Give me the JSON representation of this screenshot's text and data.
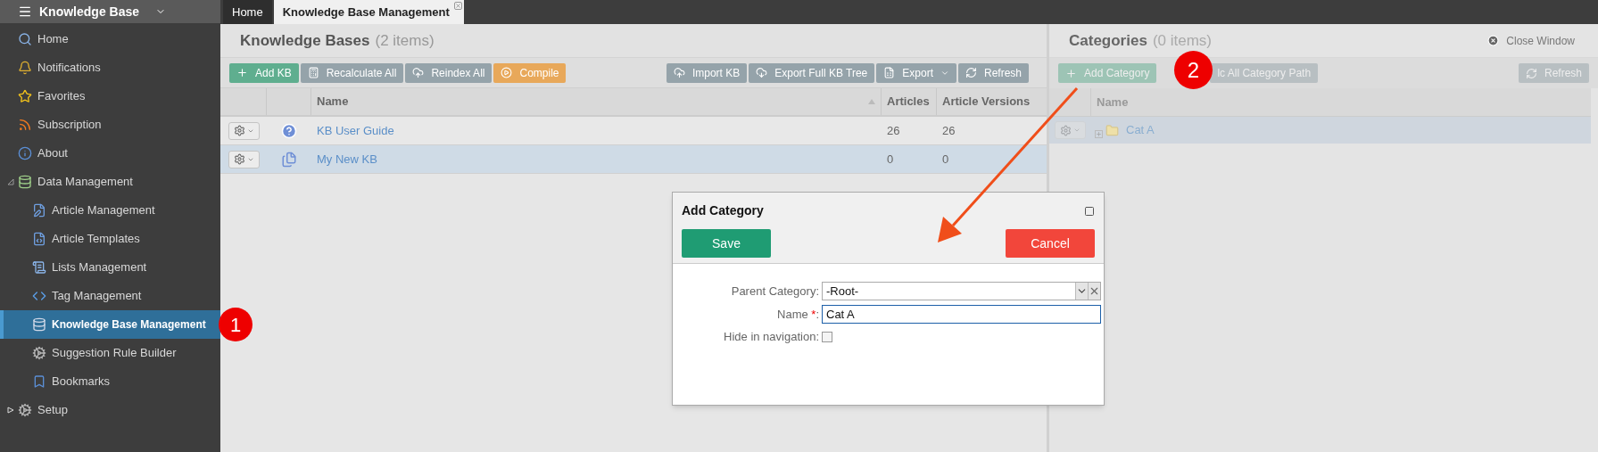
{
  "sidebar": {
    "title": "Knowledge Base",
    "items": [
      {
        "label": "Home",
        "selected": false
      },
      {
        "label": "Notifications",
        "selected": false
      },
      {
        "label": "Favorites",
        "selected": false
      },
      {
        "label": "Subscription",
        "selected": false
      },
      {
        "label": "About",
        "selected": false
      },
      {
        "label": "Data Management",
        "selected": false,
        "expanded": true,
        "children": [
          {
            "label": "Article Management",
            "selected": false
          },
          {
            "label": "Article Templates",
            "selected": false
          },
          {
            "label": "Lists Management",
            "selected": false
          },
          {
            "label": "Tag Management",
            "selected": false
          },
          {
            "label": "Knowledge Base Management",
            "selected": true
          },
          {
            "label": "Suggestion Rule Builder",
            "selected": false
          },
          {
            "label": "Bookmarks",
            "selected": false
          }
        ]
      },
      {
        "label": "Setup",
        "selected": false,
        "expanded": false
      }
    ]
  },
  "tabs": [
    {
      "label": "Home",
      "selected": false,
      "closable": false
    },
    {
      "label": "Knowledge Base Management",
      "selected": true,
      "closable": true
    }
  ],
  "kb_panel": {
    "title": "Knowledge Bases",
    "count": "(2 items)",
    "toolbar_left": [
      {
        "label": "Add KB",
        "kind": "add"
      },
      {
        "label": "Recalculate All",
        "kind": "calc"
      },
      {
        "label": "Reindex All",
        "kind": "upload"
      },
      {
        "label": "Compile",
        "kind": "play"
      }
    ],
    "toolbar_right": [
      {
        "label": "Import KB",
        "kind": "upload"
      },
      {
        "label": "Export Full KB Tree",
        "kind": "download"
      },
      {
        "label": "Export",
        "kind": "excel"
      },
      {
        "label": "Refresh",
        "kind": "refresh"
      }
    ],
    "columns": [
      "Name",
      "Articles",
      "Article Versions"
    ],
    "rows": [
      {
        "name": "KB User Guide",
        "articles": "26",
        "versions": "26",
        "selected": false,
        "kind": "help"
      },
      {
        "name": "My New KB",
        "articles": "0",
        "versions": "0",
        "selected": true,
        "kind": "docs"
      }
    ]
  },
  "categories_panel": {
    "title": "Categories",
    "count": "(0 items)",
    "close": "Close Window",
    "toolbar_left": [
      {
        "label": "Add Category",
        "kind": "add"
      },
      {
        "label": "lc All Category Path",
        "kind": "plain"
      }
    ],
    "toolbar_right": [
      {
        "label": "Refresh",
        "kind": "refresh"
      }
    ],
    "columns": [
      "Name"
    ],
    "rows": [
      {
        "name": "Cat A",
        "selected": true
      }
    ]
  },
  "dialog": {
    "title": "Add Category",
    "save": "Save",
    "cancel": "Cancel",
    "parent_label": "Parent Category:",
    "parent_value": "-Root-",
    "name_label": "Name",
    "required_mark": "*",
    "label_end": ":",
    "name_value": "Cat A",
    "hide_label": "Hide in navigation:",
    "hide_checked": false
  },
  "annotations": [
    {
      "label": "1"
    },
    {
      "label": "2"
    }
  ]
}
